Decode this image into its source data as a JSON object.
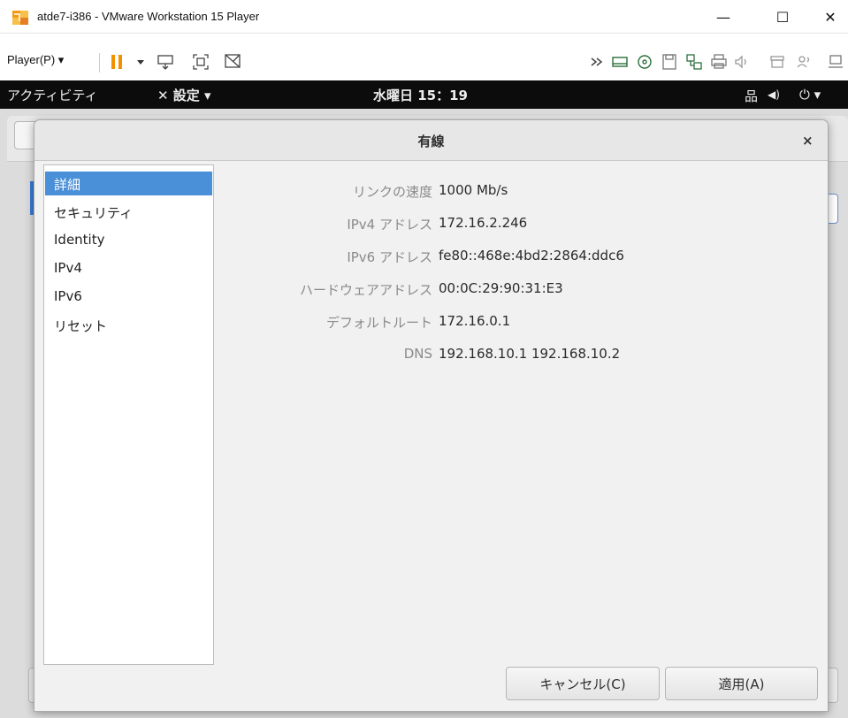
{
  "window": {
    "title": "atde7-i386 - VMware Workstation 15 Player",
    "minimize_glyph": "—",
    "maximize_glyph": "☐",
    "close_glyph": "✕"
  },
  "toolbar": {
    "player_menu": "Player(P) ▾",
    "icons": [
      "pause-icon",
      "dropdown-icon",
      "send-ctrl-alt-del-icon",
      "fit-guest-icon",
      "unity-icon",
      "forward-icon",
      "hdd-icon",
      "cd-icon",
      "floppy-icon",
      "network-icon",
      "printer-icon",
      "sound-icon",
      "usb-icon",
      "user-icon",
      "display-icon"
    ]
  },
  "gnome": {
    "activities": "アクティビティ",
    "settings_menu": "✕ 設定 ▾",
    "clock": "水曜日 15：19",
    "network_glyph": "品",
    "volume_glyph": "◀)",
    "power_glyph": "⏻ ▾"
  },
  "dialog": {
    "title": "有線",
    "close_glyph": "×",
    "sidebar": [
      {
        "label": "詳細",
        "selected": true
      },
      {
        "label": "セキュリティ",
        "selected": false
      },
      {
        "label": "Identity",
        "selected": false
      },
      {
        "label": "IPv4",
        "selected": false
      },
      {
        "label": "IPv6",
        "selected": false
      },
      {
        "label": "リセット",
        "selected": false
      }
    ],
    "details": [
      {
        "label": "リンクの速度",
        "value": "1000 Mb/s"
      },
      {
        "label": "IPv4 アドレス",
        "value": "172.16.2.246"
      },
      {
        "label": "IPv6 アドレス",
        "value": "fe80::468e:4bd2:2864:ddc6"
      },
      {
        "label": "ハードウェアアドレス",
        "value": "00:0C:29:90:31:E3"
      },
      {
        "label": "デフォルトルート",
        "value": "172.16.0.1"
      },
      {
        "label": "DNS",
        "value": "192.168.10.1 192.168.10.2"
      }
    ],
    "cancel_label": "キャンセル(C)",
    "apply_label": "適用(A)"
  },
  "colors": {
    "selection": "#4a90d9",
    "gnome_bar": "#0c0c0c",
    "pause_orange": "#f29100"
  }
}
